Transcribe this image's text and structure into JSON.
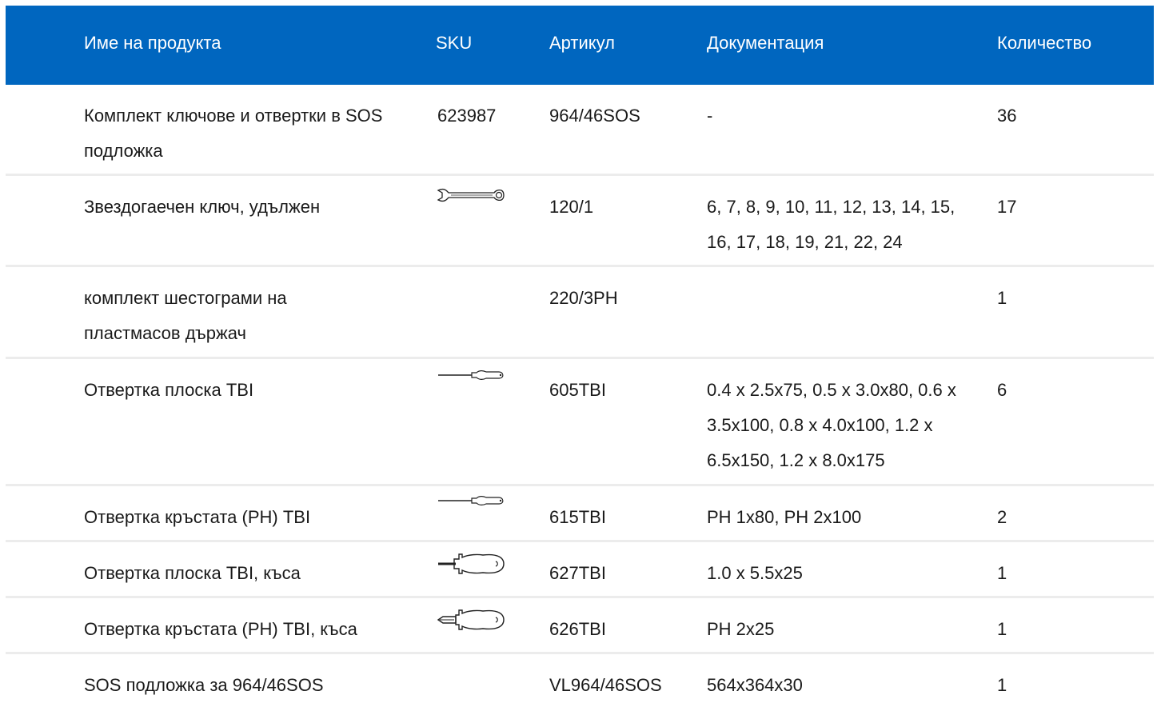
{
  "header": {
    "name": "Име на продукта",
    "sku": "SKU",
    "article": "Артикул",
    "docs": "Документация",
    "qty": "Количество"
  },
  "rows": [
    {
      "name": "Комплект ключове и отвертки в SOS подложка",
      "sku": "623987",
      "article": "964/46SOS",
      "docs": "-",
      "qty": "36",
      "icon": "none"
    },
    {
      "name": "Звездогаечен ключ, удължен",
      "sku": "",
      "article": "120/1",
      "docs": "6, 7, 8, 9, 10, 11, 12, 13, 14, 15, 16, 17, 18, 19, 21, 22, 24",
      "qty": "17",
      "icon": "combination-wrench-icon"
    },
    {
      "name": "комплект шестограми на пластмасов държач",
      "sku": "",
      "article": "220/3PH",
      "docs": "",
      "qty": "1",
      "icon": "none"
    },
    {
      "name": "Отвертка плоска TBI",
      "sku": "",
      "article": "605TBI",
      "docs": "0.4 x 2.5x75, 0.5 x 3.0x80, 0.6 x 3.5x100, 0.8 x 4.0x100, 1.2 x 6.5x150, 1.2 x 8.0x175",
      "qty": "6",
      "icon": "flat-screwdriver-icon"
    },
    {
      "name": "Отвертка кръстата (PH) TBI",
      "sku": "",
      "article": "615TBI",
      "docs": "PH 1x80, PH 2x100",
      "qty": "2",
      "icon": "phillips-screwdriver-icon"
    },
    {
      "name": "Отвертка плоска TBI, къса",
      "sku": "",
      "article": "627TBI",
      "docs": "1.0 x 5.5x25",
      "qty": "1",
      "icon": "stubby-flat-screwdriver-icon"
    },
    {
      "name": "Отвертка кръстата (PH) TBI, къса",
      "sku": "",
      "article": "626TBI",
      "docs": "PH 2x25",
      "qty": "1",
      "icon": "stubby-phillips-screwdriver-icon"
    },
    {
      "name": "SOS подложка за 964/46SOS",
      "sku": "",
      "article": "VL964/46SOS",
      "docs": "564x364x30",
      "qty": "1",
      "icon": "none"
    }
  ],
  "colors": {
    "header_bg": "#0066bf",
    "header_text": "#ffffff",
    "divider": "#ececec"
  }
}
